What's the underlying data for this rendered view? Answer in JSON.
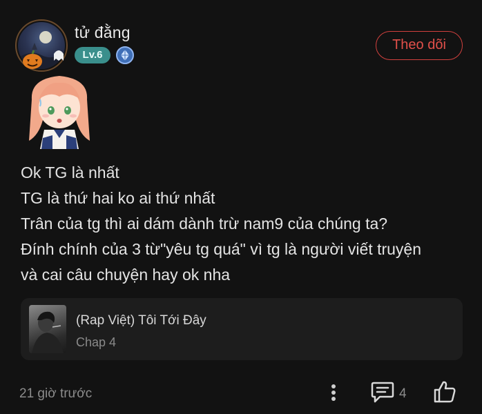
{
  "user": {
    "name": "tử đằng",
    "level": "Lv.6"
  },
  "follow_button": {
    "label": "Theo dõi",
    "color": "#d2413e"
  },
  "comment": {
    "lines": [
      "Ok TG là nhất",
      "TG là thứ hai ko ai thứ nhất",
      "Trân của tg thì ai dám dành trừ nam9 của chúng ta?",
      "Đính chính của 3 từ\"yêu tg quá\" vì tg là người viết truyện",
      "và cai câu chuyện hay ok nha"
    ]
  },
  "story": {
    "title": "(Rap Việt) Tôi Tới Đây",
    "chapter": "Chap 4"
  },
  "footer": {
    "timestamp": "21 giờ trước",
    "reply_count": "4",
    "icons": [
      "more-vertical-icon",
      "reply-icon",
      "like-icon"
    ]
  },
  "colors": {
    "background": "#121212",
    "level_badge": "#3a8f8c",
    "accent_red": "#d2413e"
  }
}
